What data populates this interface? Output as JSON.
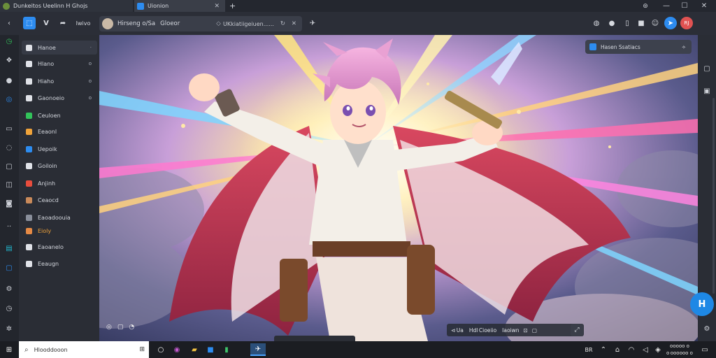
{
  "tabs": [
    {
      "title": "Dunkeitos Ueelinn H Ghojs",
      "active": true
    },
    {
      "title": "Uionion",
      "active": false
    }
  ],
  "new_tab_glyph": "+",
  "window_controls": {
    "minimize": "—",
    "maximize": "☐",
    "close": "✕"
  },
  "toolbar": {
    "profile_label": "Iwivo",
    "address_text": "Hirseng o/Sa  Gloeor",
    "address_sub": "  UKkiatiigeiuen......",
    "right_badge": "RJ"
  },
  "sidebar": {
    "items": [
      {
        "label": "Hanoe",
        "icon_color": "#e0e2e8",
        "marker": "·",
        "active": true
      },
      {
        "label": "Hlano",
        "icon_color": "#e0e2e8",
        "marker": "o",
        "active": false
      },
      {
        "label": "Hiaho",
        "icon_color": "#e0e2e8",
        "marker": "o",
        "active": false
      },
      {
        "label": "Gaonoeio",
        "icon_color": "#e0e2e8",
        "marker": "o",
        "active": false
      },
      {
        "label": "Ceuloen",
        "icon_color": "#32c35a",
        "marker": "",
        "active": false
      },
      {
        "label": "Eeaonl",
        "icon_color": "#f0a33a",
        "marker": "",
        "active": false
      },
      {
        "label": "Uepoik",
        "icon_color": "#2d8cf0",
        "marker": "",
        "active": false
      },
      {
        "label": "Goiloin",
        "icon_color": "#e0e2e8",
        "marker": "",
        "active": false
      },
      {
        "label": "Anjinh",
        "icon_color": "#e94d3d",
        "marker": "",
        "active": false
      },
      {
        "label": "Ceaocd",
        "icon_color": "#c98a5a",
        "marker": "",
        "active": false
      },
      {
        "label": "Eaoadoouia",
        "icon_color": "#8a8f9b",
        "marker": "",
        "active": false
      },
      {
        "label": "Eioly",
        "icon_color": "#e68a45",
        "marker": "",
        "active": false,
        "highlight": true
      },
      {
        "label": "Eaoanelo",
        "icon_color": "#e0e2e8",
        "marker": "",
        "active": false
      },
      {
        "label": "Eeaugn",
        "icon_color": "#e0e2e8",
        "marker": "",
        "active": false
      }
    ]
  },
  "panel": {
    "title": "Hasen Ssatiacs"
  },
  "art_controls": {
    "left_icons": [
      "◎",
      "▢",
      "◔"
    ],
    "bar_text_1": " Ua",
    "bar_text_2": "Hdl Cioeiio",
    "bar_text_3": "Iaoiwn"
  },
  "fab_icon": "H",
  "taskbar": {
    "search_placeholder": "Hlooddooon",
    "tray_text_1": "BR",
    "time": "ooooo o",
    "date": "o oooooo o"
  },
  "colors": {
    "accent": "#2d8cf0",
    "fab": "#1e88e5",
    "sky_top": "#3b4064",
    "burst": "#fff6c8",
    "hair": "#e89ad0",
    "cape": "#c23a4e"
  }
}
